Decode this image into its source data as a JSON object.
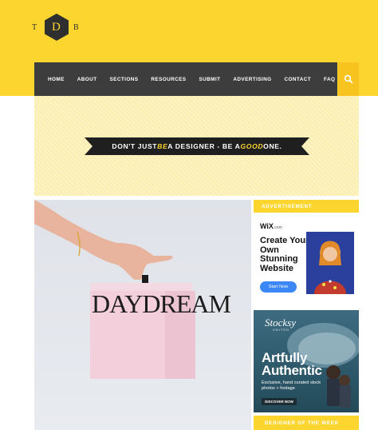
{
  "logo": {
    "letters": [
      "T",
      "D",
      "B"
    ]
  },
  "nav": {
    "items": [
      "HOME",
      "ABOUT",
      "SECTIONS",
      "RESOURCES",
      "SUBMIT",
      "ADVERTISING",
      "CONTACT",
      "FAQ"
    ]
  },
  "hero": {
    "tagline_part1": "DON'T JUST ",
    "tagline_em1": "BE",
    "tagline_part2": " A DESIGNER - BE A ",
    "tagline_em2": "GOOD",
    "tagline_part3": " ONE."
  },
  "feature": {
    "box_label": "DAYDREAM"
  },
  "sidebar": {
    "advertisement_label": "ADVERTISEMENT",
    "wix_ad": {
      "logo": "WiX",
      "logo_suffix": ".com",
      "headline": "Create Your Own Stunning Website",
      "button": "Start Now"
    },
    "stocksy_ad": {
      "logo": "Stocksy",
      "logo_sub": "UNITED",
      "headline_line1": "Artfully",
      "headline_line2": "Authentic",
      "description": "Exclusive, hand curated stock photos + footage",
      "button": "DISCOVER NOW"
    },
    "designer_of_week_label": "DESIGNER OF THE WEEK"
  },
  "colors": {
    "brand_yellow": "#fcd62f",
    "nav_dark": "#3d3d3d",
    "search_yellow": "#f6c31f"
  }
}
